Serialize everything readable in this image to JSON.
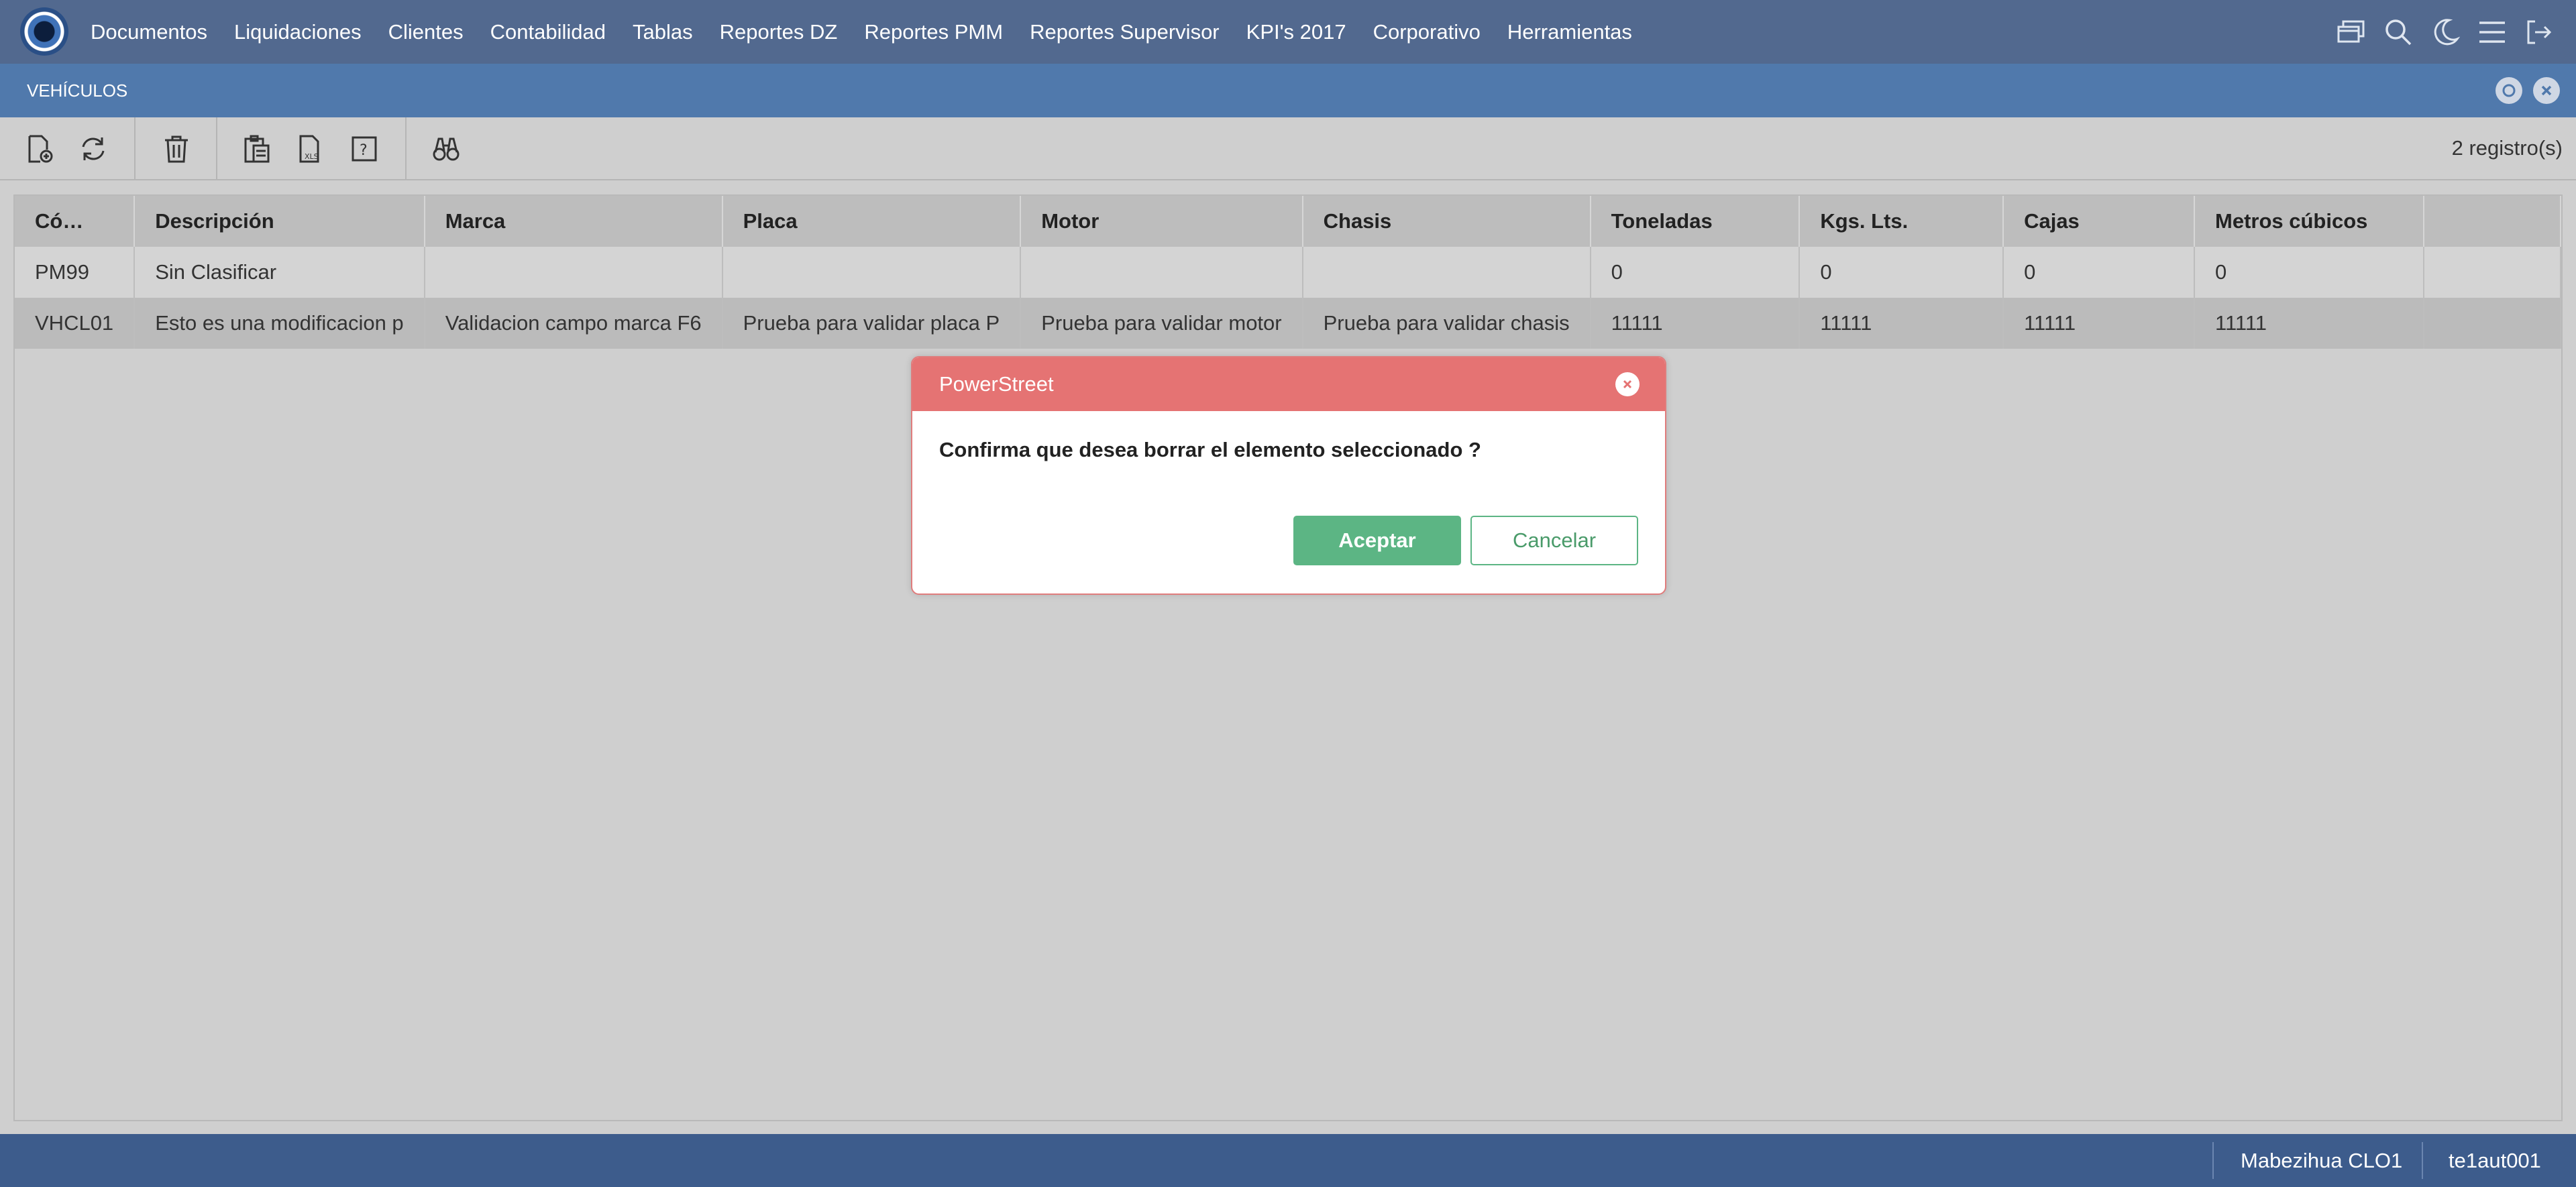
{
  "nav": {
    "items": [
      "Documentos",
      "Liquidaciones",
      "Clientes",
      "Contabilidad",
      "Tablas",
      "Reportes DZ",
      "Reportes PMM",
      "Reportes Supervisor",
      "KPI's 2017",
      "Corporativo",
      "Herramientas"
    ],
    "icons": [
      "windows-icon",
      "search-icon",
      "moon-icon",
      "menu-icon",
      "logout-icon"
    ]
  },
  "window": {
    "title": "VEHÍCULOS"
  },
  "toolbar": {
    "icons": [
      "new-document-icon",
      "refresh-icon",
      "delete-icon",
      "clipboard-icon",
      "export-xls-icon",
      "help-icon",
      "binoculars-icon"
    ],
    "records": "2 registro(s)"
  },
  "grid": {
    "headers": [
      "Có…",
      "Descripción",
      "Marca",
      "Placa",
      "Motor",
      "Chasis",
      "Toneladas",
      "Kgs. Lts.",
      "Cajas",
      "Metros cúbicos",
      ""
    ],
    "rows": [
      [
        "PM99",
        "Sin Clasificar",
        "",
        "",
        "",
        "",
        "0",
        "0",
        "0",
        "0",
        ""
      ],
      [
        "VHCL01",
        "Esto es una modificacion p",
        "Validacion campo marca F6",
        "Prueba para validar placa P",
        "Prueba para validar motor",
        "Prueba para validar chasis",
        "11111",
        "11111",
        "11111",
        "11111",
        ""
      ]
    ]
  },
  "dialog": {
    "title": "PowerStreet",
    "message": "Confirma que desea borrar el elemento seleccionado ?",
    "ok_label": "Aceptar",
    "cancel_label": "Cancelar"
  },
  "footer": {
    "user": "Mabezihua CLO1",
    "code": "te1aut001"
  },
  "colors": {
    "nav": "#52698f",
    "titlebar": "#5079ac",
    "footer": "#3d5c8c",
    "dialog_header": "#e57373",
    "ok_button": "#5cb584"
  }
}
